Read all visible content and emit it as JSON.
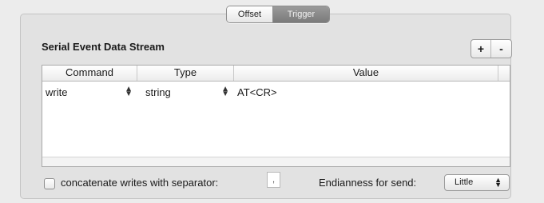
{
  "tabs": {
    "offset": "Offset",
    "trigger": "Trigger",
    "selected": "Trigger"
  },
  "section": {
    "title": "Serial Event Data Stream",
    "add_label": "+",
    "remove_label": "-"
  },
  "table": {
    "headers": [
      "Command",
      "Type",
      "Value"
    ],
    "rows": [
      {
        "command": "write",
        "type": "string",
        "value": "AT<CR>"
      }
    ]
  },
  "footer": {
    "concatenate_label": "concatenate writes with separator:",
    "concatenate_checked": false,
    "separator_value": ",",
    "endianness_label": "Endianness for send:",
    "endianness_value": "Little"
  },
  "icons": {
    "stepper": "up-down-arrows-icon",
    "select": "up-down-arrows-icon"
  }
}
